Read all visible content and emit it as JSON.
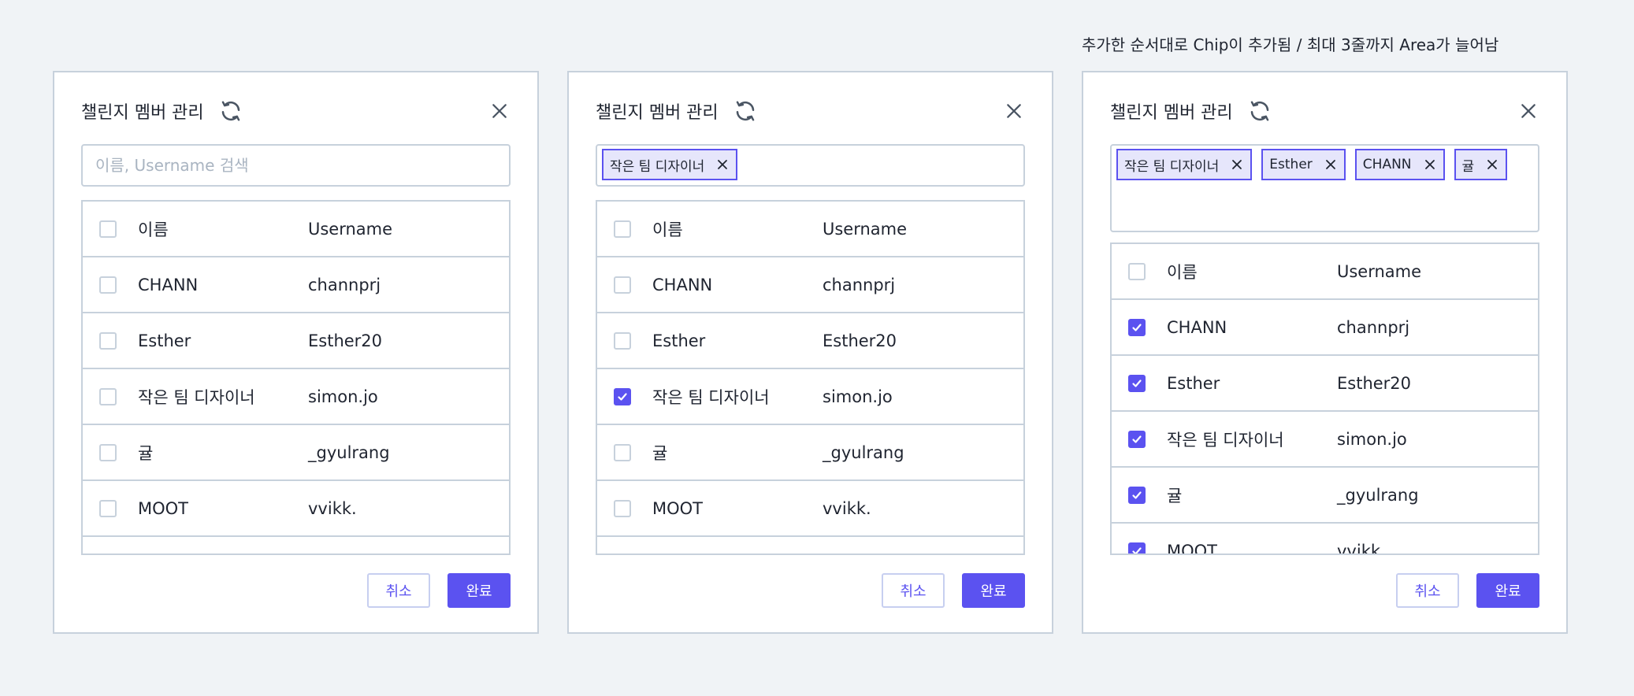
{
  "annotation": "추가한 순서대로 Chip이 추가됨 / 최대 3줄까지 Area가 늘어남",
  "colors": {
    "accent": "#5b52f0",
    "border": "#c7d1dc",
    "background": "#f0f3f6"
  },
  "dialogs": [
    {
      "title": "챌린지 멤버 관리",
      "search_placeholder": "이름, Username 검색",
      "chips": [],
      "header": {
        "name": "이름",
        "username": "Username"
      },
      "rows": [
        {
          "name": "CHANN",
          "username": "channprj",
          "checked": false
        },
        {
          "name": "Esther",
          "username": "Esther20",
          "checked": false
        },
        {
          "name": "작은 팀 디자이너",
          "username": "simon.jo",
          "checked": false
        },
        {
          "name": "귤",
          "username": "_gyulrang",
          "checked": false
        },
        {
          "name": "MOOT",
          "username": "vvikk.",
          "checked": false
        }
      ],
      "cancel_label": "취소",
      "done_label": "완료"
    },
    {
      "title": "챌린지 멤버 관리",
      "chips": [
        "작은 팀 디자이너"
      ],
      "header": {
        "name": "이름",
        "username": "Username"
      },
      "rows": [
        {
          "name": "CHANN",
          "username": "channprj",
          "checked": false
        },
        {
          "name": "Esther",
          "username": "Esther20",
          "checked": false
        },
        {
          "name": "작은 팀 디자이너",
          "username": "simon.jo",
          "checked": true
        },
        {
          "name": "귤",
          "username": "_gyulrang",
          "checked": false
        },
        {
          "name": "MOOT",
          "username": "vvikk.",
          "checked": false
        }
      ],
      "cancel_label": "취소",
      "done_label": "완료"
    },
    {
      "title": "챌린지 멤버 관리",
      "chips": [
        "작은 팀 디자이너",
        "Esther",
        "CHANN",
        "귤"
      ],
      "header": {
        "name": "이름",
        "username": "Username"
      },
      "rows": [
        {
          "name": "CHANN",
          "username": "channprj",
          "checked": true
        },
        {
          "name": "Esther",
          "username": "Esther20",
          "checked": true
        },
        {
          "name": "작은 팀 디자이너",
          "username": "simon.jo",
          "checked": true
        },
        {
          "name": "귤",
          "username": "_gyulrang",
          "checked": true
        },
        {
          "name": "MOOT",
          "username": "vvikk.",
          "checked": true
        }
      ],
      "cancel_label": "취소",
      "done_label": "완료"
    }
  ]
}
